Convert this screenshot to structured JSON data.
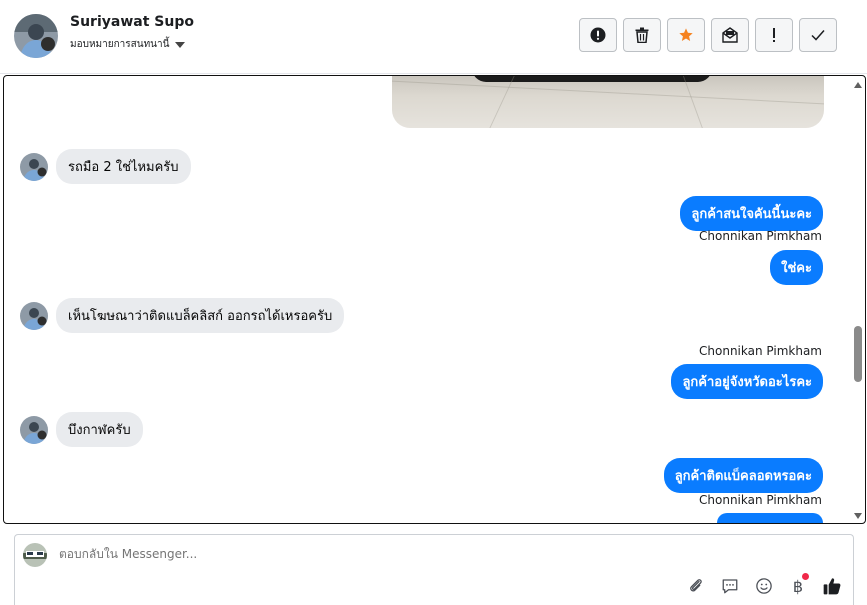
{
  "header": {
    "contact_name": "Suriyawat Supo",
    "assign_label": "มอบหมายการสนทนานี้",
    "actions": [
      {
        "name": "report-button",
        "icon": "exclamation-circle-icon"
      },
      {
        "name": "delete-button",
        "icon": "trash-icon"
      },
      {
        "name": "star-button",
        "icon": "star-icon",
        "color": "#f5821f"
      },
      {
        "name": "mark-unread-button",
        "icon": "envelope-icon"
      },
      {
        "name": "flag-button",
        "icon": "exclamation-icon"
      },
      {
        "name": "done-button",
        "icon": "check-icon"
      }
    ]
  },
  "messages": {
    "m1": "รถมือ 2 ใช่ไหมครับ",
    "m2": "ลูกค้าสนใจคันนี้นะคะ",
    "m2_sender": "Chonnikan Pimkham",
    "m3": "ใช่คะ",
    "m4": "เห็นโฆษณาว่าติดแบล็คลิสก์ ออกรถได้เหรอครับ",
    "m5_sender": "Chonnikan Pimkham",
    "m5": "ลูกค้าอยู่จังหวัดอะไรคะ",
    "m6": "บึงกาฬครับ",
    "m7": "ลูกค้าติดแบ็คลอดหรอคะ",
    "m7_sender": "Chonnikan Pimkham"
  },
  "composer": {
    "placeholder": "ตอบกลับใน Messenger...",
    "tools": [
      "paperclip-icon",
      "saved-reply-icon",
      "emoji-icon",
      "baht-payment-icon",
      "like-icon"
    ],
    "baht_symbol": "฿"
  },
  "colors": {
    "outgoing": "#0a7cff",
    "incoming": "#e9ebee",
    "star": "#f5821f",
    "notification_dot": "#f02849"
  }
}
